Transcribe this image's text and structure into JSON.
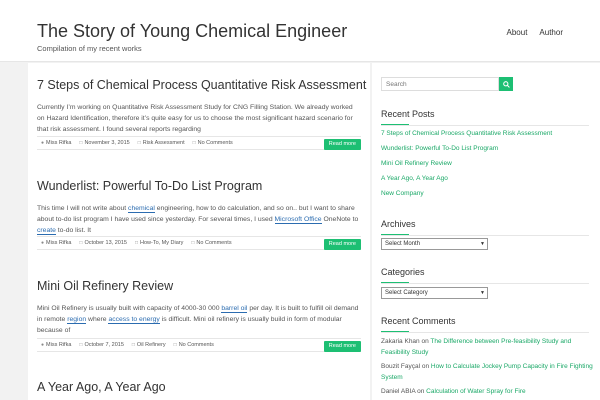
{
  "header": {
    "site_title": "The Story of Young Chemical Engineer",
    "site_description": "Compilation of my recent works",
    "nav": [
      {
        "label": "About"
      },
      {
        "label": "Author"
      }
    ]
  },
  "posts": [
    {
      "title": "7 Steps of Chemical Process Quantitative Risk Assessment",
      "excerpt": "Currently I’m working on Quantitative Risk Assessment Study for CNG Filling Station. We already worked on Hazard Identification, therefore it’s quite easy for us to choose the most significant hazard scenario for that risk assessment. I found several reports regarding",
      "author": "Miss Rifka",
      "date": "November 3, 2015",
      "category": "Risk Assessment",
      "comments": "No Comments",
      "read_more": "Read more"
    },
    {
      "title": "Wunderlist: Powerful To-Do List Program",
      "excerpt_parts": [
        "This time I will not write about ",
        "chemical",
        " engineering, how to do calculation, and so on.. but I want to share about to-do list program I have used since yesterday. For several times, I used ",
        "Microsoft Office",
        " OneNote to ",
        "create",
        " to-do list. It"
      ],
      "author": "Miss Rifka",
      "date": "October 13, 2015",
      "category": "How-To, My Diary",
      "comments": "No Comments",
      "read_more": "Read more"
    },
    {
      "title": "Mini Oil Refinery Review",
      "excerpt_parts": [
        "Mini Oil Refinery is usually built with capacity of 4000-30 000 ",
        "barrel oil",
        " per day. It is built to fulfill oil demand in remote ",
        "region",
        " where ",
        "access to energy",
        " is difficult. Mini oil refinery is usually build in form of modular because of"
      ],
      "author": "Miss Rifka",
      "date": "October 7, 2015",
      "category": "Oil Refinery",
      "comments": "No Comments",
      "read_more": "Read more"
    },
    {
      "title": "A Year Ago, A Year Ago"
    }
  ],
  "sidebar": {
    "search_placeholder": "Search",
    "recent_posts_title": "Recent Posts",
    "recent_posts": [
      "7 Steps of Chemical Process Quantitative Risk Assessment",
      "Wunderlist: Powerful To-Do List Program",
      "Mini Oil Refinery Review",
      "A Year Ago, A Year Ago",
      "New Company"
    ],
    "archives_title": "Archives",
    "archives_select": "Select Month",
    "categories_title": "Categories",
    "categories_select": "Select Category",
    "recent_comments_title": "Recent Comments",
    "recent_comments": [
      {
        "author": "Zakaria Khan",
        "on": " on ",
        "post": "The Difference between Pre-feasibility Study and Feasibility Study"
      },
      {
        "author": "Bouzit Fayçal",
        "on": " on ",
        "post": "How to Calculate Jockey Pump Capacity in Fire Fighting System"
      },
      {
        "author": "Daniel ABIA",
        "on": " on ",
        "post": "Calculation of Water Spray for Fire"
      }
    ]
  },
  "colors": {
    "accent": "#1dbf73",
    "link": "#1aa867",
    "inline_link": "#2b6cb0"
  }
}
